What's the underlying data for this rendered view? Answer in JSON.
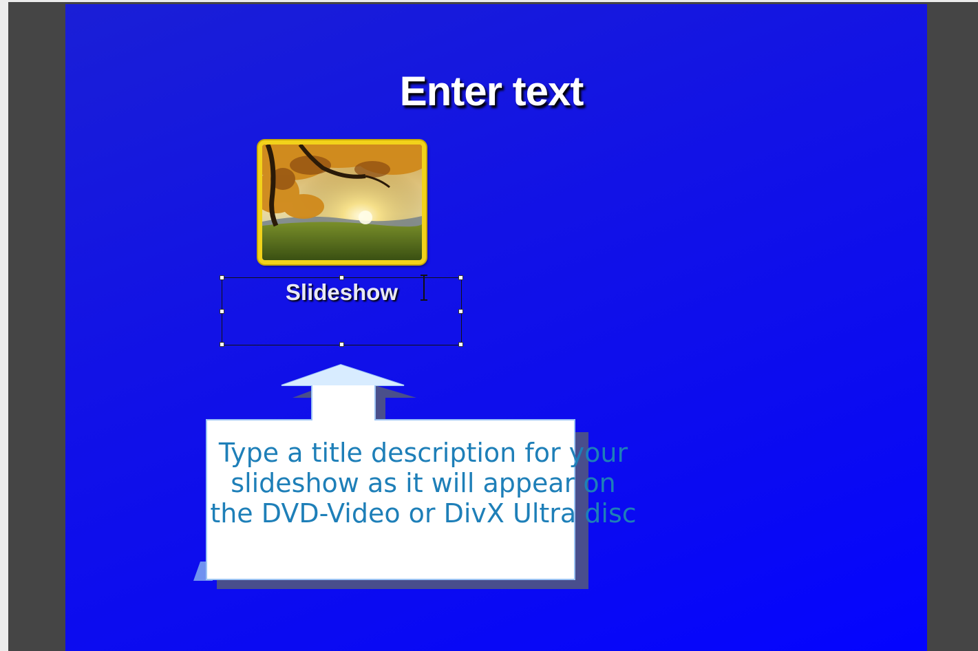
{
  "menu": {
    "title": "Enter text",
    "button_caption": "Slideshow"
  },
  "tooltip": {
    "text": "Type a title description for your slideshow as it will appear on the DVD-Video or DivX Ultra disc"
  },
  "colors": {
    "background": "#0a0af2",
    "thumbnail_border": "#f2d21a",
    "tooltip_text": "#1e7fb8"
  },
  "icons": {
    "thumbnail": "autumn-tree-photo",
    "cursor": "text-ibeam-cursor",
    "callout_arrow": "up-arrow"
  }
}
